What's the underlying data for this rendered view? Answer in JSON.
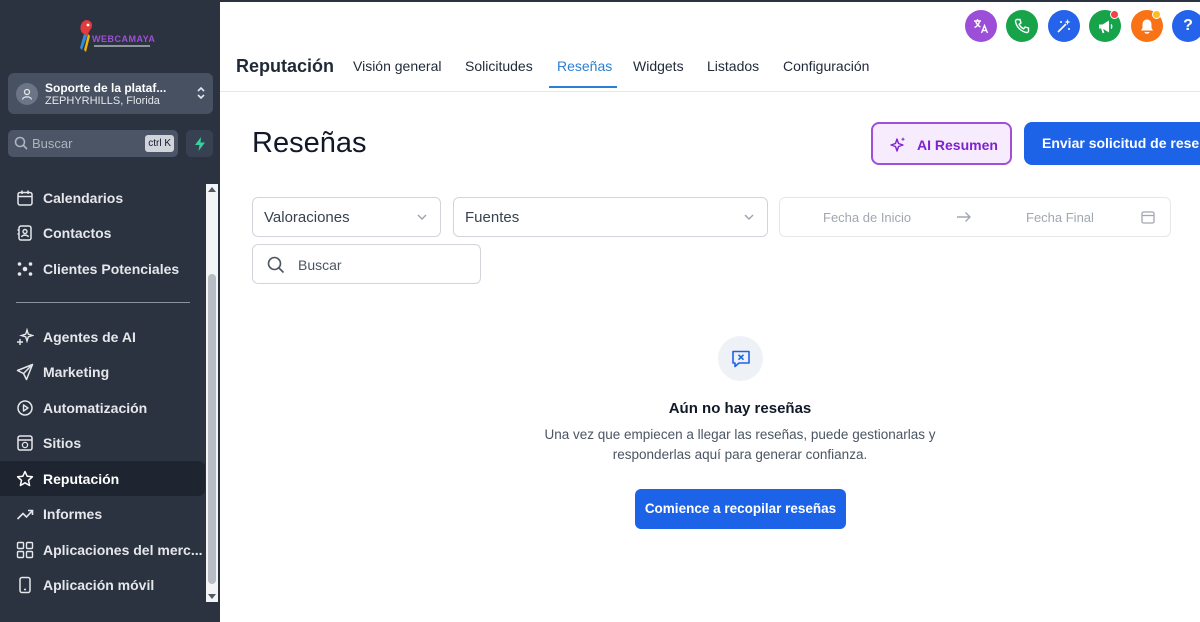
{
  "sidebar": {
    "logo_text": "WEBCAMAYA",
    "account": {
      "name": "Soporte de la plataf...",
      "location": "ZEPHYRHILLS, Florida"
    },
    "search": {
      "placeholder": "Buscar",
      "shortcut": "ctrl K"
    },
    "nav": [
      {
        "label": "Calendarios",
        "icon": "calendar-icon"
      },
      {
        "label": "Contactos",
        "icon": "contacts-icon"
      },
      {
        "label": "Clientes Potenciales",
        "icon": "leads-icon"
      },
      {
        "label": "Agentes de AI",
        "icon": "sparkle-icon"
      },
      {
        "label": "Marketing",
        "icon": "send-icon"
      },
      {
        "label": "Automatización",
        "icon": "automation-icon"
      },
      {
        "label": "Sitios",
        "icon": "sites-icon"
      },
      {
        "label": "Reputación",
        "icon": "star-icon",
        "active": true
      },
      {
        "label": "Informes",
        "icon": "trend-icon"
      },
      {
        "label": "Aplicaciones del merc...",
        "icon": "apps-grid-icon"
      },
      {
        "label": "Aplicación móvil",
        "icon": "mobile-icon"
      }
    ]
  },
  "header": {
    "icons": [
      {
        "name": "translate-icon",
        "color": "#9b4fd8"
      },
      {
        "name": "phone-icon",
        "color": "#16a34a"
      },
      {
        "name": "magic-icon",
        "color": "#2563eb"
      },
      {
        "name": "megaphone-icon",
        "color": "#16a34a",
        "dot": "#ef4444"
      },
      {
        "name": "bell-icon",
        "color": "#f97316",
        "dot": "#fbbf24"
      },
      {
        "name": "help-icon",
        "color": "#2563eb"
      }
    ]
  },
  "nav": {
    "module_title": "Reputación",
    "tabs": [
      "Visión general",
      "Solicitudes",
      "Reseñas",
      "Widgets",
      "Listados",
      "Configuración"
    ],
    "active_tab": "Reseñas"
  },
  "main": {
    "title": "Reseñas",
    "ai_button": "AI Resumen",
    "send_button": "Enviar solicitud de reseña",
    "filters": {
      "ratings": "Valoraciones",
      "sources": "Fuentes",
      "start_date": "Fecha de Inicio",
      "end_date": "Fecha Final"
    },
    "search_placeholder": "Buscar",
    "empty": {
      "title": "Aún no hay reseñas",
      "line1": "Una vez que empiecen a llegar las reseñas, puede gestionarlas y",
      "line2": "responderlas aquí para generar confianza.",
      "cta": "Comience a recopilar reseñas"
    }
  },
  "colors": {
    "sidebar_bg": "#2b3340",
    "accent": "#1d63e8",
    "tab_active": "#2b7fd4",
    "ai_purple": "#a04fd8"
  }
}
